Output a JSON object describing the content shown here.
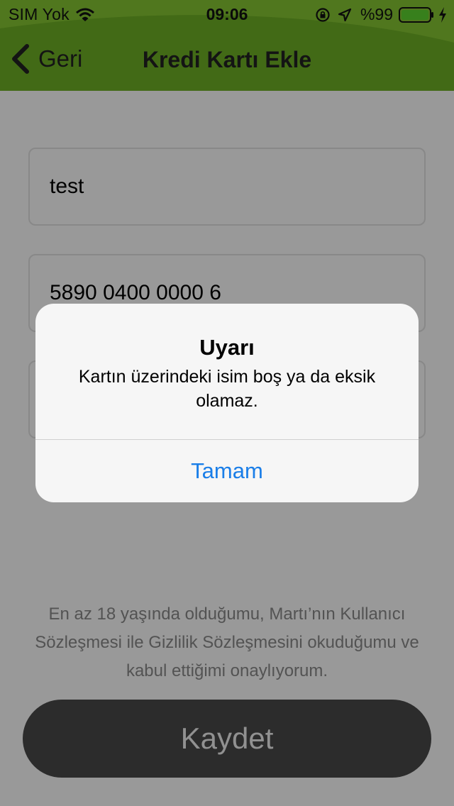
{
  "status_bar": {
    "carrier": "SIM Yok",
    "time": "09:06",
    "battery": "%99",
    "icons": [
      "wifi-icon",
      "rotation-lock-icon",
      "location-icon",
      "battery-icon",
      "charging-bolt-icon"
    ]
  },
  "nav": {
    "back_label": "Geri",
    "title": "Kredi Kartı Ekle"
  },
  "form": {
    "name_value": "test",
    "card_value": "5890 0400 0000 6",
    "extra_value": ""
  },
  "terms_text": "En az 18 yaşında olduğumu, Martı’nın Kullanıcı Sözleşmesi ile Gizlilik Sözleşmesini okuduğumu ve kabul ettiğimi onaylıyorum.",
  "save_label": "Kaydet",
  "alert": {
    "title": "Uyarı",
    "message": "Kartın üzerindeki isim boş ya da eksik olamaz.",
    "ok_label": "Tamam"
  },
  "colors": {
    "header_green": "#76b82a",
    "header_green_light": "#8ccb35",
    "save_button": "#4a4a4a",
    "alert_action": "#1a7ee8"
  }
}
